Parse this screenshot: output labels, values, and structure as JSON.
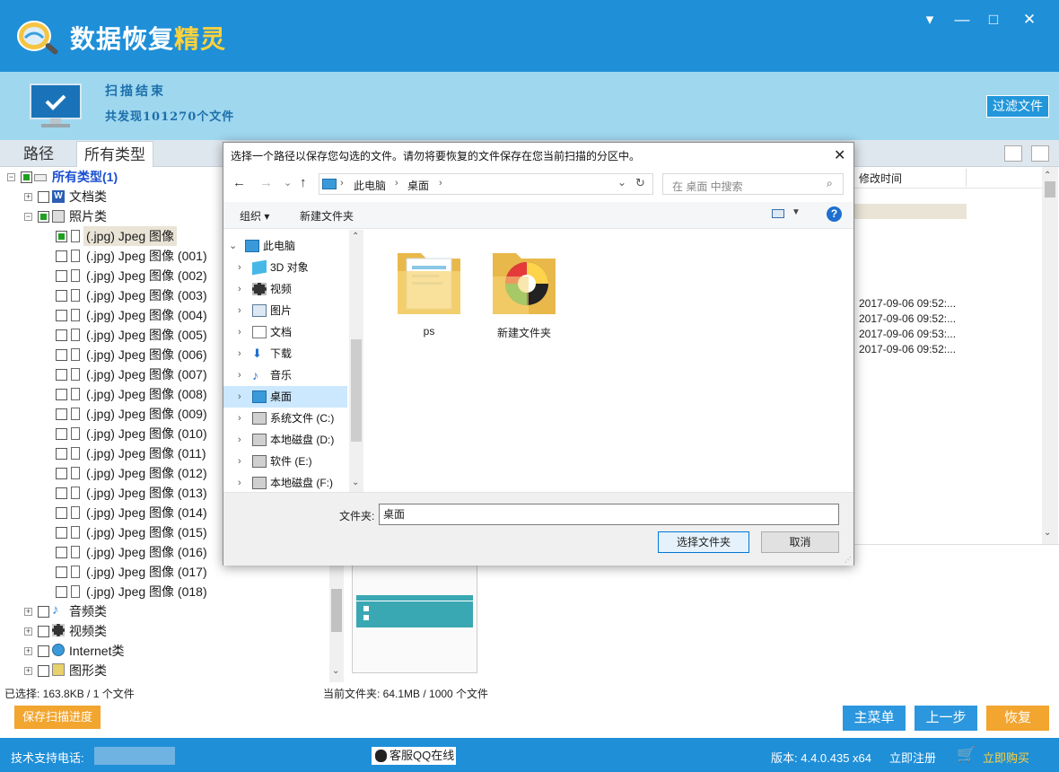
{
  "app": {
    "title_main": "数据恢复",
    "title_accent": "精灵",
    "window_buttons": [
      "▾",
      "—",
      "□",
      "✕"
    ]
  },
  "scan": {
    "title": "扫描结束",
    "count_text": "共发现101270个文件",
    "filter_button": "过滤文件"
  },
  "tabs": [
    "路径",
    "所有类型"
  ],
  "tree": {
    "root": "所有类型(1)",
    "docs": "文档类",
    "photos": "照片类",
    "photo_items": [
      "(.jpg) Jpeg 图像",
      "(.jpg) Jpeg 图像 (001)",
      "(.jpg) Jpeg 图像 (002)",
      "(.jpg) Jpeg 图像 (003)",
      "(.jpg) Jpeg 图像 (004)",
      "(.jpg) Jpeg 图像 (005)",
      "(.jpg) Jpeg 图像 (006)",
      "(.jpg) Jpeg 图像 (007)",
      "(.jpg) Jpeg 图像 (008)",
      "(.jpg) Jpeg 图像 (009)",
      "(.jpg) Jpeg 图像 (010)",
      "(.jpg) Jpeg 图像 (011)",
      "(.jpg) Jpeg 图像 (012)",
      "(.jpg) Jpeg 图像 (013)",
      "(.jpg) Jpeg 图像 (014)",
      "(.jpg) Jpeg 图像 (015)",
      "(.jpg) Jpeg 图像 (016)",
      "(.jpg) Jpeg 图像 (017)",
      "(.jpg) Jpeg 图像 (018)"
    ],
    "audio": "音频类",
    "video": "视频类",
    "internet": "Internet类",
    "graphics": "图形类"
  },
  "filelist": {
    "column_modified": "修改时间",
    "dates": [
      "2017-09-06 09:52:...",
      "2017-09-06 09:52:...",
      "2017-09-06 09:53:...",
      "2017-09-06 09:52:..."
    ]
  },
  "status": {
    "selected": "已选择: 163.8KB / 1 个文件",
    "current_folder": "当前文件夹: 64.1MB / 1000 个文件"
  },
  "actions": {
    "save_progress": "保存扫描进度",
    "main_menu": "主菜单",
    "prev_step": "上一步",
    "recover": "恢复"
  },
  "footer": {
    "support_label": "技术支持电话:",
    "qq": "客服QQ在线",
    "version": "版本: 4.4.0.435 x64",
    "register": "立即注册",
    "buy": "立即购买"
  },
  "dialog": {
    "title": "选择一个路径以保存您勾选的文件。请勿将要恢复的文件保存在您当前扫描的分区中。",
    "close": "✕",
    "breadcrumb": [
      "此电脑",
      "桌面"
    ],
    "search_placeholder": "在 桌面 中搜索",
    "organize": "组织 ▾",
    "new_folder": "新建文件夹",
    "nav_items": [
      "此电脑",
      "3D 对象",
      "视频",
      "图片",
      "文档",
      "下载",
      "音乐",
      "桌面",
      "系统文件 (C:)",
      "本地磁盘 (D:)",
      "软件 (E:)",
      "本地磁盘 (F:)"
    ],
    "folders": [
      "ps",
      "新建文件夹"
    ],
    "folder_label": "文件夹:",
    "folder_value": "桌面",
    "select_button": "选择文件夹",
    "cancel_button": "取消"
  },
  "colors": {
    "brand_blue": "#1f8fd8",
    "info_bg": "#9fd7ef",
    "orange": "#f2a52f",
    "accent_yellow": "#ffd23a"
  }
}
